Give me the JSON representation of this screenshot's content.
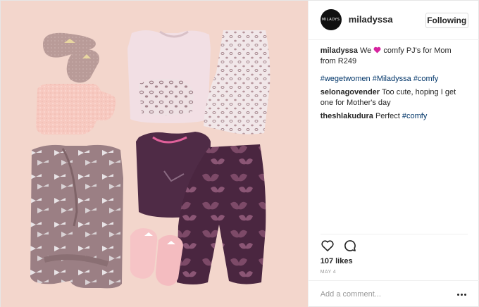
{
  "post": {
    "username": "miladyssa",
    "avatar_text": "MILADYS",
    "follow_label": "Following",
    "caption": {
      "username": "miladyssa",
      "text_before": "We",
      "emoji": "purple-heart-icon",
      "text_after": "comfy PJ's for Mom from R249"
    },
    "hashtags": [
      "#wegetwomen",
      "#Miladyssa",
      "#comfy"
    ],
    "comments": [
      {
        "username": "selonagovender",
        "text": "Too cute, hoping I get one for Mother's day",
        "tag": ""
      },
      {
        "username": "theshlakudura",
        "text": "Perfect",
        "tag": "#comfy"
      }
    ],
    "likes": "107 likes",
    "date": "MAY 4",
    "comment_placeholder": "Add a comment...",
    "icons": {
      "like": "heart-outline-icon",
      "comment": "speech-bubble-icon",
      "more": "ellipsis-icon"
    },
    "colors": {
      "background_image": "#f3d6cc",
      "tag_blue": "#003569",
      "heart_emoji": "#d6249f"
    }
  }
}
